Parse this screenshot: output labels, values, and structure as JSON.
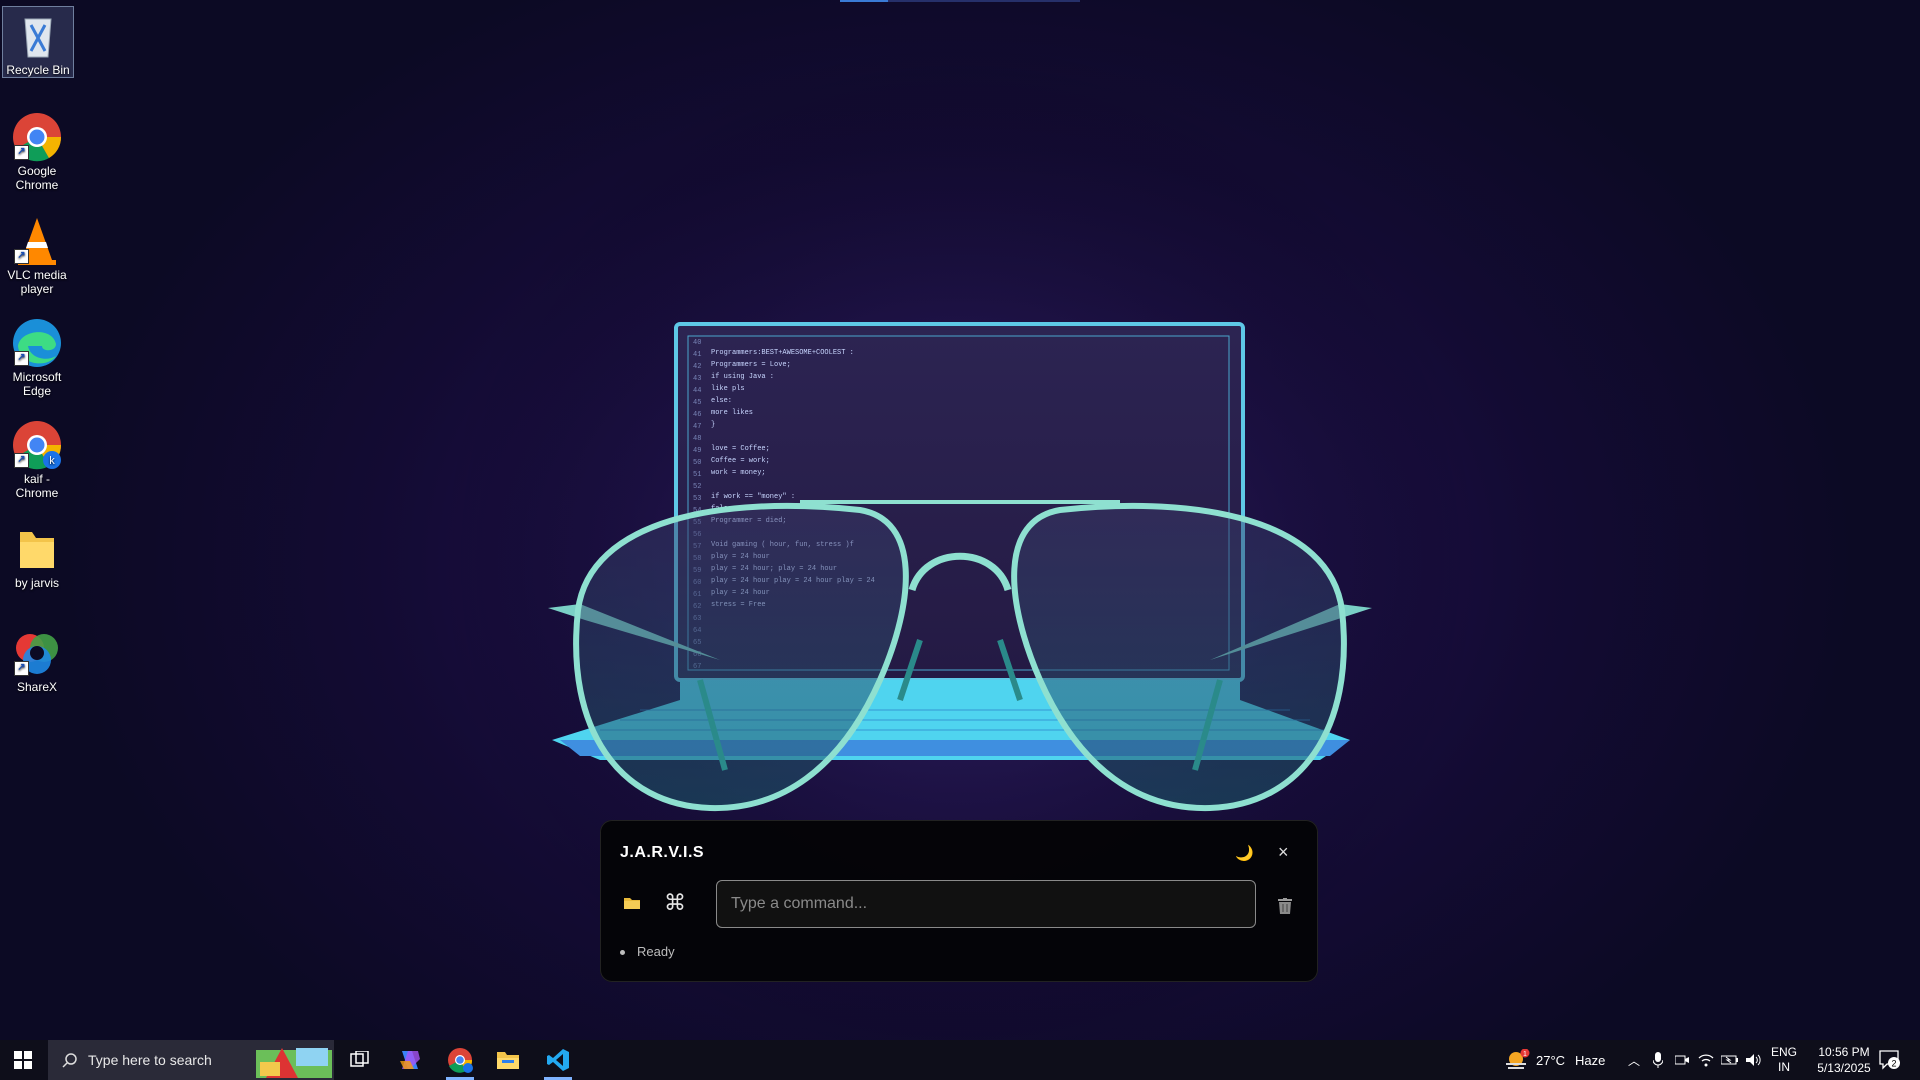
{
  "desktop": {
    "icons": [
      {
        "label": "Recycle Bin",
        "icon": "recycle-bin-icon"
      },
      {
        "label": "Google Chrome",
        "icon": "chrome-icon"
      },
      {
        "label": "VLC media player",
        "icon": "vlc-icon"
      },
      {
        "label": "Microsoft Edge",
        "icon": "edge-icon"
      },
      {
        "label": "kaif - Chrome",
        "icon": "chrome-profile-icon",
        "badge": "k"
      },
      {
        "label": "by jarvis",
        "icon": "folder-icon"
      },
      {
        "label": "ShareX",
        "icon": "sharex-icon"
      }
    ]
  },
  "wallpaper": {
    "code_lines": [
      "Programmers:BEST+AWESOME+COOLEST :",
      "Programmers = Love;",
      "if using Java :",
      "    like pls",
      "else:",
      "    more likes",
      "}",
      "",
      "love = Coffee;",
      "Coffee = work;",
      "work = money;",
      "",
      "if work == \"money\" :",
      "    false",
      "    Programmer = died;",
      "",
      "Void gaming ( hour, fun, stress )f",
      "    play = 24 hour",
      "    play = 24 hour; play = 24 hour",
      "    play = 24 hour play = 24 hour play = 24",
      "    play = 24 hour",
      "    stress = Free"
    ],
    "colors": {
      "frame": "#5ec8e6",
      "glasses": "#7ad0c6",
      "keyboard": "#54b4e6"
    }
  },
  "jarvis": {
    "title": "J.A.R.V.I.S",
    "theme_icon": "moon-icon",
    "close_label": "×",
    "command_icon_label": "⌘",
    "input_placeholder": "Type a command...",
    "status": "Ready"
  },
  "taskbar": {
    "search_placeholder": "Type here to search",
    "apps": [
      "task-view-icon",
      "copilot-icon",
      "chrome-profile-icon",
      "file-explorer-icon",
      "vscode-icon"
    ],
    "weather": {
      "temp": "27°C",
      "condition": "Haze",
      "alert": "1"
    },
    "language": {
      "line1": "ENG",
      "line2": "IN"
    },
    "time": "10:56 PM",
    "date": "5/13/2025",
    "notifications": "2"
  }
}
